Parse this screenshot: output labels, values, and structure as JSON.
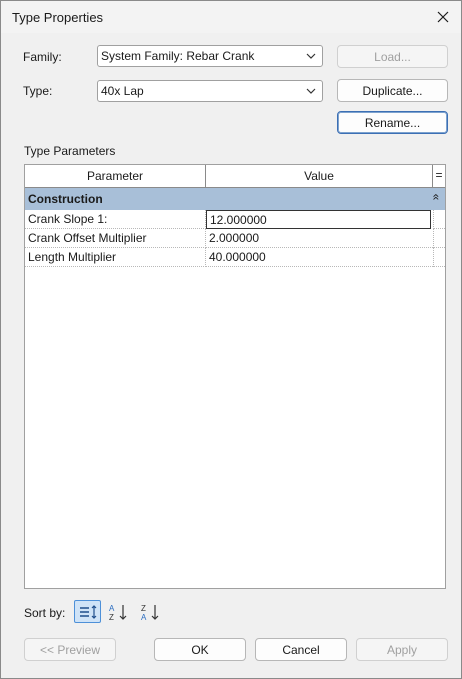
{
  "window": {
    "title": "Type Properties"
  },
  "family": {
    "label": "Family:",
    "value": "System Family: Rebar Crank",
    "load_label": "Load..."
  },
  "type": {
    "label": "Type:",
    "value": "40x Lap",
    "duplicate_label": "Duplicate...",
    "rename_label": "Rename..."
  },
  "type_parameters": {
    "section_label": "Type Parameters",
    "columns": {
      "parameter": "Parameter",
      "value": "Value",
      "extra": "="
    },
    "group": {
      "name": "Construction",
      "collapse_glyph": "«"
    },
    "rows": [
      {
        "parameter": "Crank Slope 1:",
        "value": "12.000000"
      },
      {
        "parameter": "Crank Offset Multiplier",
        "value": "2.000000"
      },
      {
        "parameter": "Length Multiplier",
        "value": "40.000000"
      }
    ]
  },
  "sort": {
    "label": "Sort by:"
  },
  "footer": {
    "preview_label": "<< Preview",
    "ok_label": "OK",
    "cancel_label": "Cancel",
    "apply_label": "Apply"
  },
  "colors": {
    "group_header": "#a8bfd8",
    "sort_selected": "#cfe3f7",
    "focus_border": "#3c6fb4"
  }
}
